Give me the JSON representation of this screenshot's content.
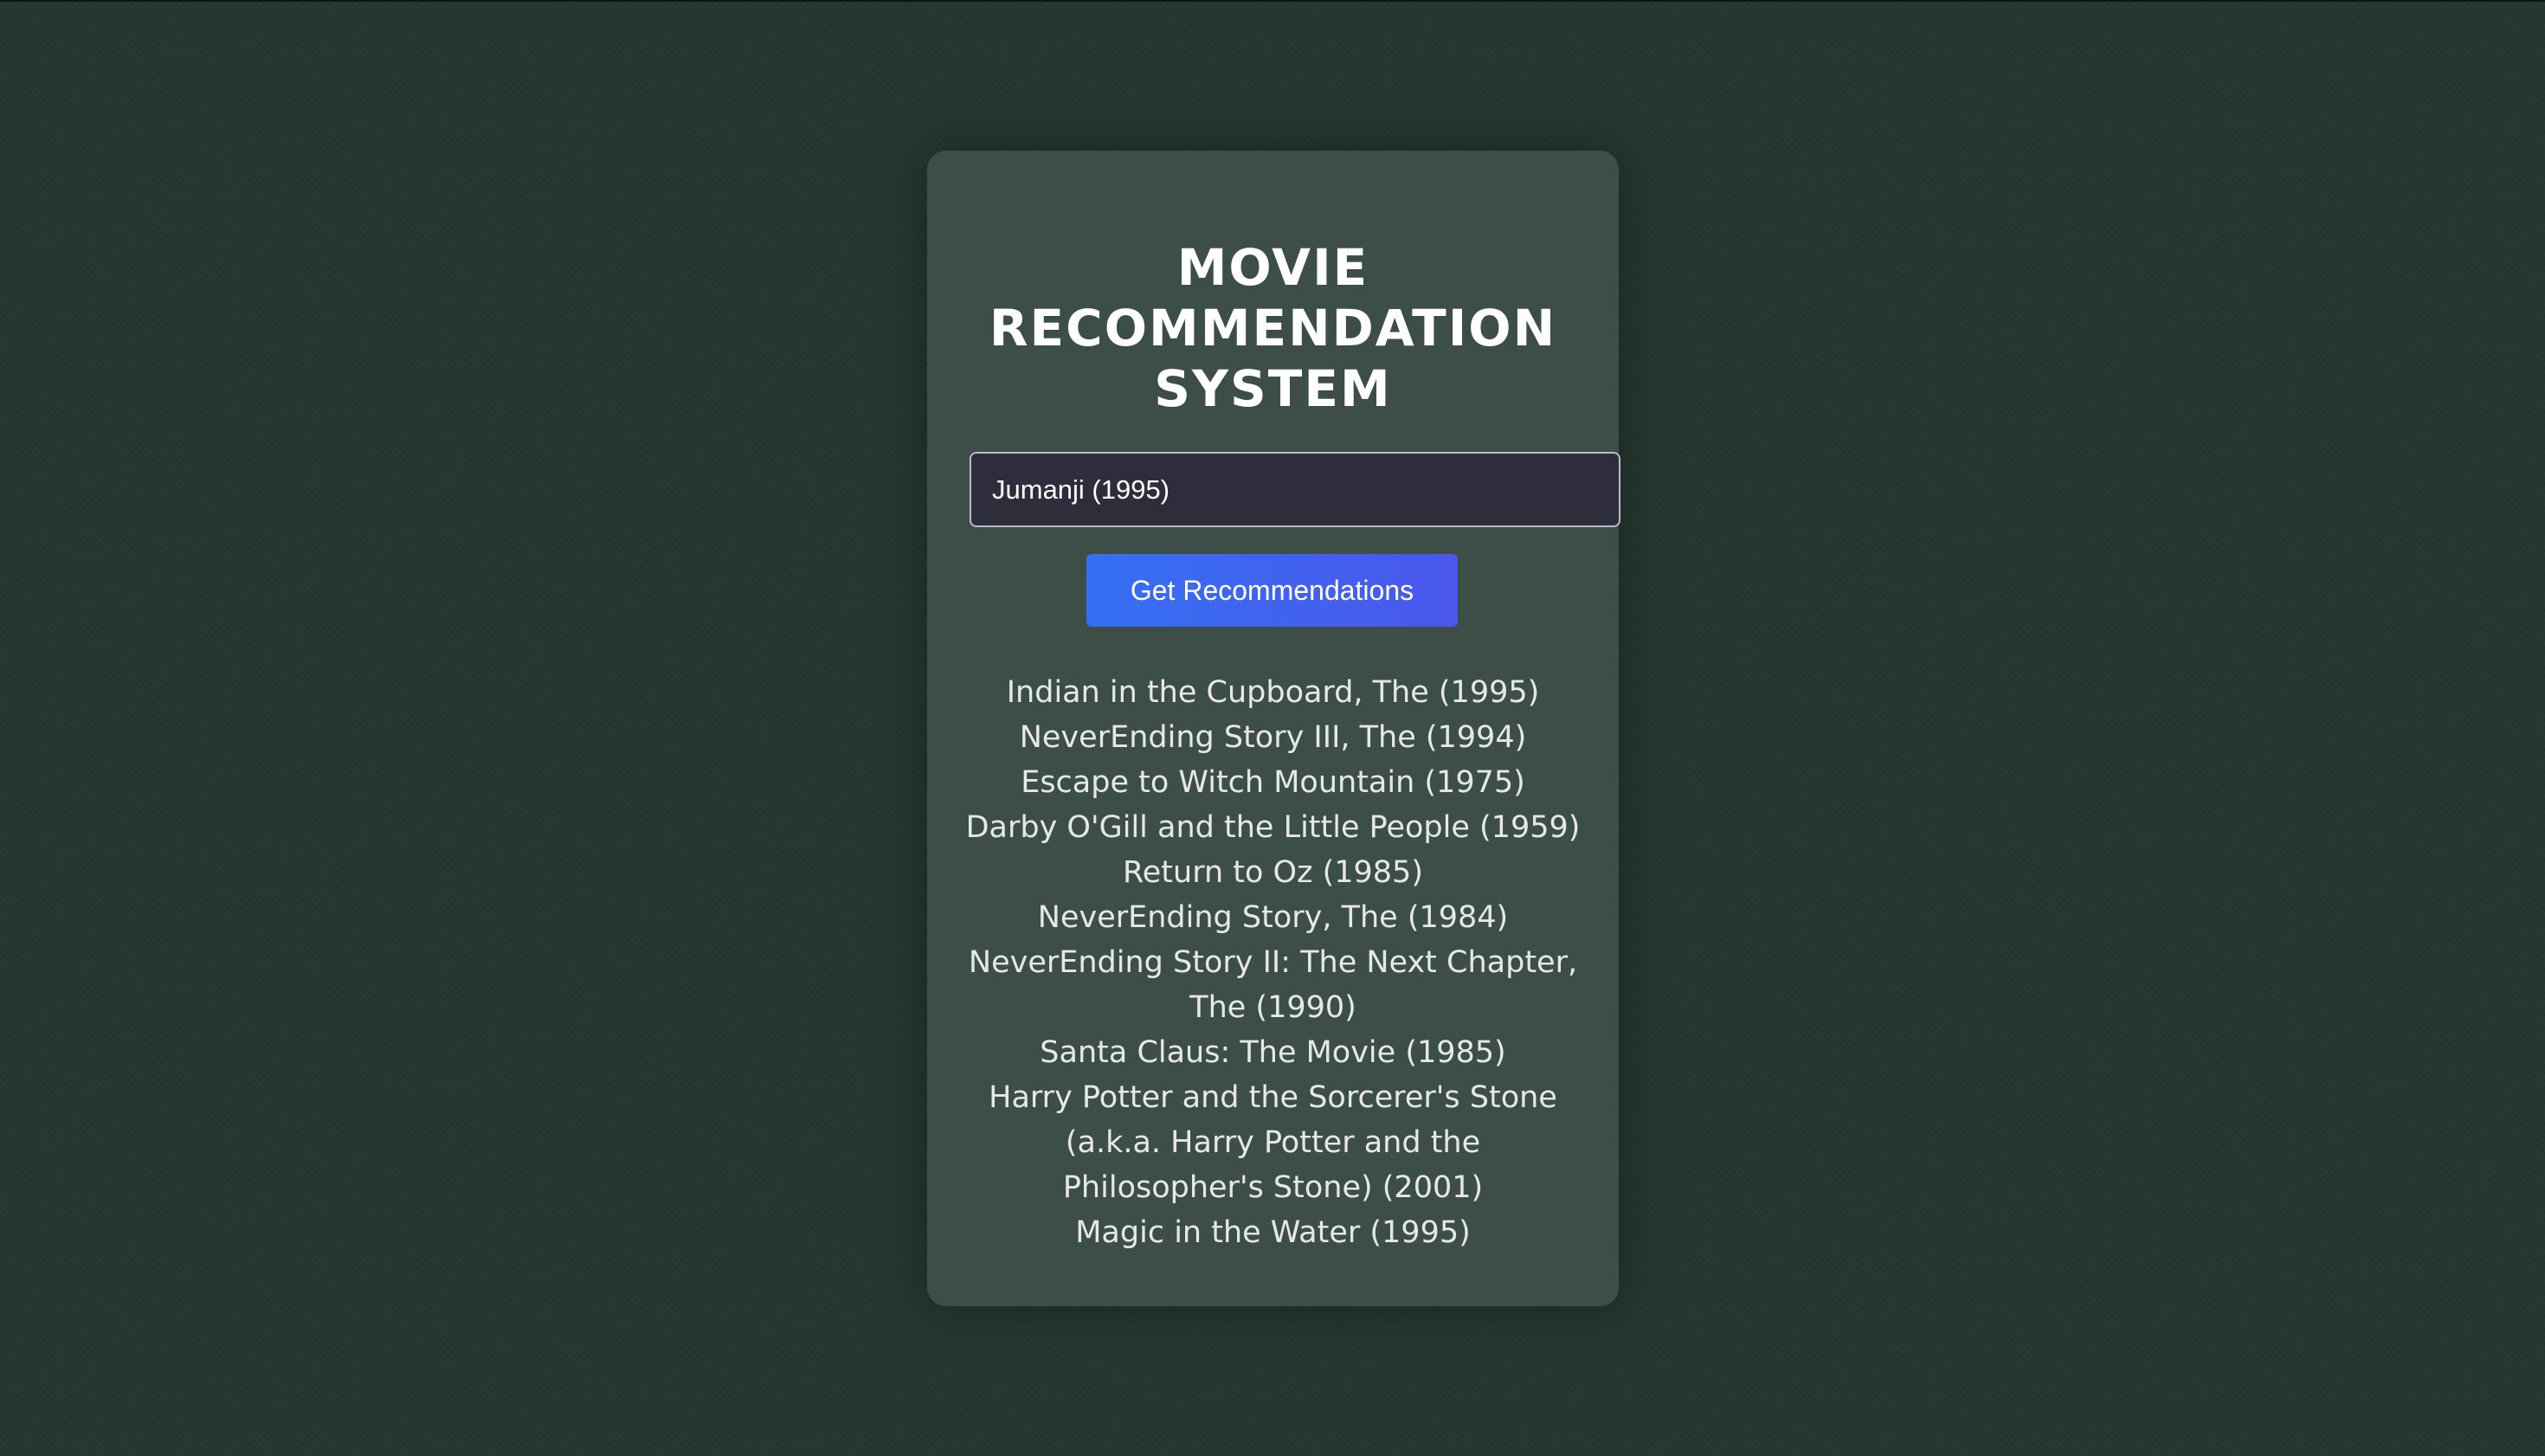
{
  "app": {
    "title": "MOVIE RECOMMENDATION SYSTEM"
  },
  "search": {
    "value": "Jumanji (1995)"
  },
  "button": {
    "label": "Get Recommendations"
  },
  "recommendations": [
    "Indian in the Cupboard, The (1995)",
    "NeverEnding Story III, The (1994)",
    "Escape to Witch Mountain (1975)",
    "Darby O'Gill and the Little People (1959)",
    "Return to Oz (1985)",
    "NeverEnding Story, The (1984)",
    "NeverEnding Story II: The Next Chapter, The (1990)",
    "Santa Claus: The Movie (1985)",
    "Harry Potter and the Sorcerer's Stone (a.k.a. Harry Potter and the Philosopher's Stone) (2001)",
    "Magic in the Water (1995)"
  ],
  "colors": {
    "background": "#263730",
    "card": "#3d4e49",
    "input_bg": "#2e2d3b",
    "button_start": "#3570f2",
    "button_end": "#4b57ec"
  }
}
